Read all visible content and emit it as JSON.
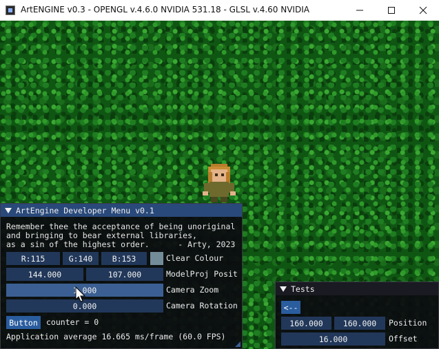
{
  "window": {
    "title": "ArtENGINE v0.3 - OPENGL v.4.6.0 NVIDIA 531.18 - GLSL v.4.60 NVIDIA",
    "minimize_icon": "minimize-icon",
    "maximize_icon": "maximize-icon",
    "close_icon": "close-icon"
  },
  "dev_menu": {
    "title": "ArtEngine Developer Menu v0.1",
    "quote_lines": [
      "Remember thee the acceptance of being unoriginal",
      "and bringing to bear external libraries,",
      "as a sin of the highest order.      - Arty, 2023"
    ],
    "color_r": "R:115",
    "color_g": "G:140",
    "color_b": "B:153",
    "clear_colour_label": "Clear Colour",
    "swatch_color": "#738c99",
    "modelproj_x": "144.000",
    "modelproj_y": "107.000",
    "modelproj_label": "ModelProj Posit",
    "camera_zoom_value": "1.000",
    "camera_zoom_label": "Camera Zoom",
    "camera_rotation_value": "0.000",
    "camera_rotation_label": "Camera Rotation",
    "button_label": "Button",
    "counter_text": "counter = 0",
    "fps_text": "Application average 16.665 ms/frame (60.0 FPS)"
  },
  "tests": {
    "title": "Tests",
    "back_button": "<--",
    "position_x": "160.000",
    "position_y": "160.000",
    "position_label": "Position",
    "offset_value": "16.000",
    "offset_label": "Offset"
  },
  "colors": {
    "panel_header": "#29497a",
    "field_bg": "#22385a",
    "button_bg": "#2a5d9e",
    "grass": "#0f5613"
  }
}
